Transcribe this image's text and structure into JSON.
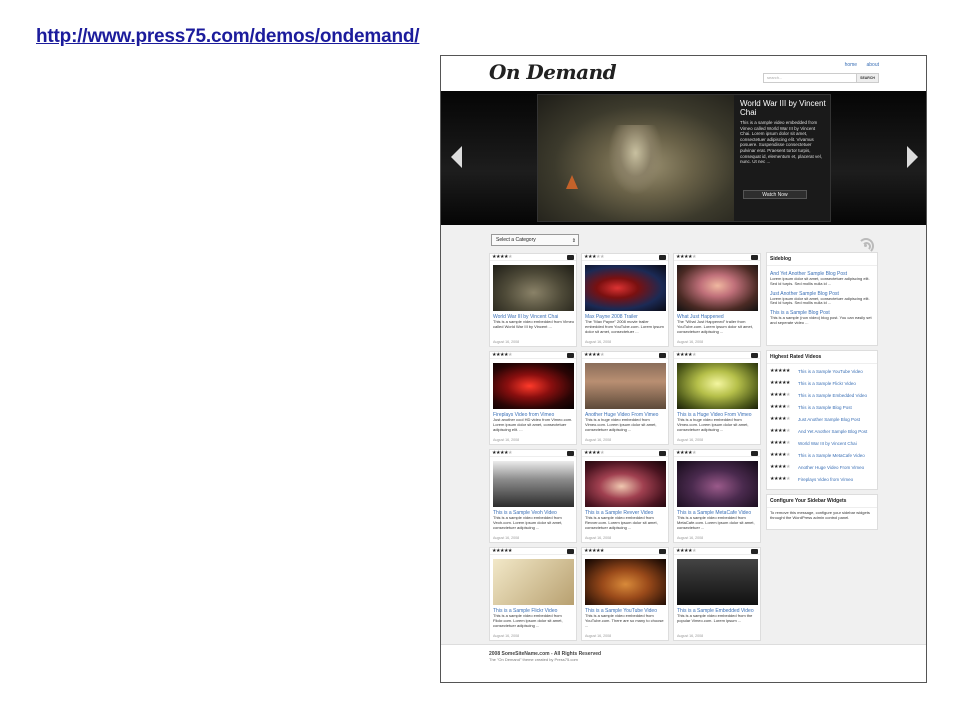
{
  "slide": {
    "url": "http://www.press75.com/demos/ondemand/"
  },
  "site": {
    "logo": "On Demand",
    "nav": [
      "home",
      "about"
    ],
    "search_placeholder": "search...",
    "search_button": "SEARCH"
  },
  "hero": {
    "title": "World War III by Vincent Chai",
    "description": "This is a sample video embedded from Vimeo called World War III by Vincent Chai. Lorem ipsum dolor sit amet, consectetuer adipiscing elit. Vivamus posuere. Suspendisse consectetuer pulvinar erat. Praesent tortor turpis, consequat id, elementum et, placerat vel, nunc. Ut nec ...",
    "button": "Watch Now"
  },
  "category_select": "Select a Category",
  "videos": [
    {
      "title": "World War III by Vincent Chai",
      "desc": "This is a sample video embedded from Vimeo called World War III by Vincent ...",
      "date": "August 16, 2008",
      "rating": 3.5
    },
    {
      "title": "Max Payne 2008 Trailer",
      "desc": "The \"Max Payne\" 2008 movie trailer embedded from YouTube.com. Lorem ipsum dolor sit amet, consectetuer ...",
      "date": "August 16, 2008",
      "rating": 2.5
    },
    {
      "title": "What Just Happened",
      "desc": "The \"What Just Happened\" trailer from YouTube.com. Lorem ipsum dolor sit amet, consectetuer adipiscing ...",
      "date": "August 16, 2008",
      "rating": 3.5
    },
    {
      "title": "Fireplays Video from Vimeo",
      "desc": "Just another cool HD video from Vimeo.com. Lorem ipsum dolor sit amet, consectetuer adipiscing elit. ...",
      "date": "August 16, 2008",
      "rating": 3.5
    },
    {
      "title": "Another Huge Video From Vimeo",
      "desc": "This is a huge video embedded from Vimeo.com. Lorem ipsum dolor sit amet, consectetuer adipiscing ...",
      "date": "August 16, 2008",
      "rating": 3.5
    },
    {
      "title": "This is a Huge Video From Vimeo",
      "desc": "This is a huge video embedded from Vimeo.com. Lorem ipsum dolor sit amet, consectetuer adipiscing ...",
      "date": "August 16, 2008",
      "rating": 3.5
    },
    {
      "title": "This is a Sample Veoh Video",
      "desc": "This is a sample video embedded from Veoh.com. Lorem ipsum dolor sit amet, consectetuer adipiscing ...",
      "date": "August 16, 2008",
      "rating": 3.5
    },
    {
      "title": "This is a Sample Revver Video",
      "desc": "This is a sample video embedded from Revver.com. Lorem ipsum dolor sit amet, consectetuer adipiscing ...",
      "date": "August 16, 2008",
      "rating": 3.5
    },
    {
      "title": "This is a Sample MetaCafe Video",
      "desc": "This is a sample video embedded from MetaCafe.com. Lorem ipsum dolor sit amet, consectetuer ...",
      "date": "August 16, 2008",
      "rating": 3.5
    },
    {
      "title": "This is a Sample Flickr Video",
      "desc": "This is a sample video embedded from Flickr.com. Lorem ipsum dolor sit amet, consectetuer adipiscing ...",
      "date": "August 16, 2008",
      "rating": 4.5
    },
    {
      "title": "This is a Sample YouTube Video",
      "desc": "This is a sample video embedded from YouTube.com. There are so many to choose ...",
      "date": "August 16, 2008",
      "rating": 5
    },
    {
      "title": "This is a Sample Embedded Video",
      "desc": "This is a sample video embedded from the popular Vimeo.com. Lorem ipsum ...",
      "date": "August 16, 2008",
      "rating": 4
    }
  ],
  "sideblog": {
    "heading": "Sideblog",
    "items": [
      {
        "title": "And Yet Another Sample Blog Post",
        "text": "Lorem ipsum dolor sit amet, consectetuer adipiscing elit. Sed id turpis. Sed mollis nulla id ..."
      },
      {
        "title": "Just Another Sample Blog Post",
        "text": "Lorem ipsum dolor sit amet, consectetuer adipiscing elit. Sed id turpis. Sed mollis nulla id ..."
      },
      {
        "title": "This is a Sample Blog Post",
        "text": "This is a sample (non video) blog post. You can easily set and seperate video ..."
      }
    ]
  },
  "highest_rated": {
    "heading": "Highest Rated Videos",
    "items": [
      {
        "title": "This is a Sample YouTube Video",
        "rating": 5
      },
      {
        "title": "This is a Sample Flickr Video",
        "rating": 4.5
      },
      {
        "title": "This is a Sample Embedded Video",
        "rating": 4
      },
      {
        "title": "This is a Sample Blog Post",
        "rating": 4
      },
      {
        "title": "Just Another Sample Blog Post",
        "rating": 4
      },
      {
        "title": "And Yet Another Sample Blog Post",
        "rating": 4
      },
      {
        "title": "World War III by Vincent Chai",
        "rating": 3.5
      },
      {
        "title": "This is a Sample MetaCafe Video",
        "rating": 3.5
      },
      {
        "title": "Another Huge Video From Vimeo",
        "rating": 3.5
      },
      {
        "title": "Fireplays Video from Vimeo",
        "rating": 3.5
      }
    ]
  },
  "configure": {
    "heading": "Configure Your Sidebar Widgets",
    "text": "To remove this message, configure your sidebar widgets throught the WordPress admin control panel."
  },
  "footer": {
    "line1": "2008 SomeSiteName.com - All Rights Reserved",
    "line2": "The \"On Demand\" theme created by Press75.com"
  },
  "colors": {
    "link": "#3a6fb5",
    "hero_bg": "#111111",
    "page_bg": "#f0f0f0"
  }
}
